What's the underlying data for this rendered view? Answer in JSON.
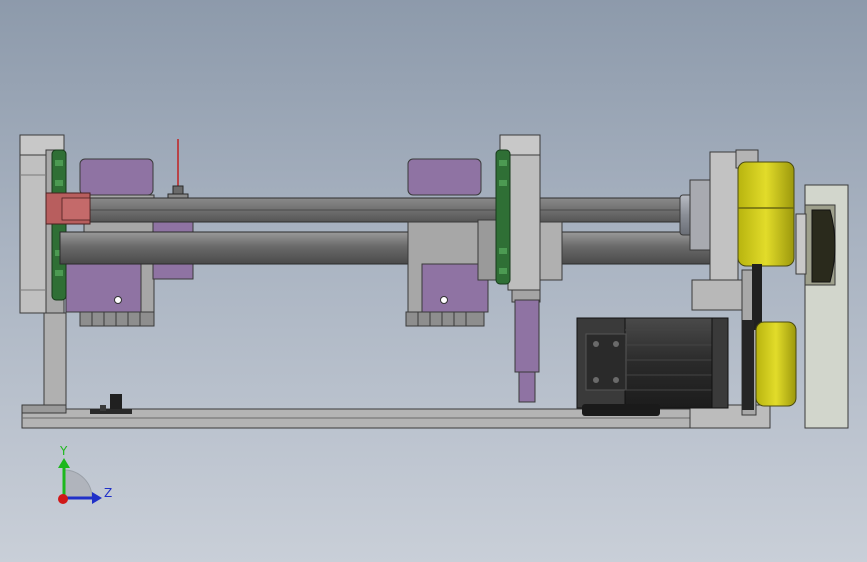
{
  "viewport": {
    "background_top": "#8d9aab",
    "background_bottom": "#c9cfd8"
  },
  "colors": {
    "steel_light": "#c4c4c4",
    "steel_mid": "#9a9a9a",
    "steel_dark": "#5e5e5e",
    "shaft": "#707070",
    "carriage_purple": "#8f73a3",
    "clamp_red": "#b85e5e",
    "sprocket_green": "#2f6f35",
    "pulley_yellow": "#d6d019",
    "motor_black": "#2e2e2e",
    "cover_panel": "#d2d6cc",
    "indicator_red": "#c02020"
  },
  "triad": {
    "y_label": "Y",
    "z_label": "Z",
    "y_color": "#1db81d",
    "z_color": "#2030c8",
    "origin_color": "#d01818"
  }
}
